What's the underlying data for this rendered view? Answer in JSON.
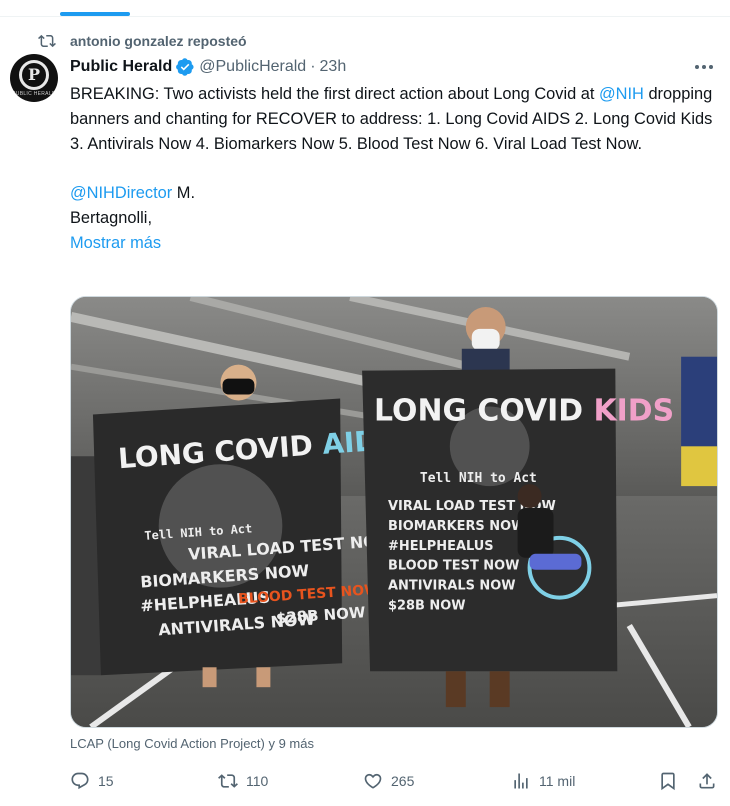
{
  "repost": {
    "text": "antonio gonzalez reposteó",
    "icon": "repost-icon"
  },
  "author": {
    "name": "Public Herald",
    "handle": "@PublicHerald",
    "separator": "·",
    "time": "23h",
    "avatar_text": "P",
    "avatar_caption": "PUBLIC HERALD",
    "verified": true
  },
  "tweet": {
    "p1_a": "BREAKING: Two activists held the first direct action about Long Covid at ",
    "p1_link": "@NIH",
    "p1_b": " dropping banners and chanting for RECOVER to address: 1. Long Covid AIDS 2. Long Covid Kids 3. Antivirals Now 4. Biomarkers Now 5. Blood Test Now 6. Viral Load Test Now.",
    "p2_link": "@NIHDirector",
    "p2_a": " M.",
    "p3": "Bertagnolli,",
    "show_more": "Mostrar más"
  },
  "media": {
    "banner_left": {
      "title_a": "LONG COVID",
      "title_b": "AIDS",
      "line1": "Tell NIH to Act",
      "line2": "VIRAL LOAD TEST NOW",
      "line3": "BIOMARKERS NOW",
      "line4": "#HELPHEALUS",
      "line5": "BLOOD TEST NOW",
      "line6": "ANTIVIRALS NOW",
      "line7": "$28B NOW"
    },
    "banner_right": {
      "title_a": "LONG COVID",
      "title_b": "KIDS",
      "line1": "Tell NIH to Act",
      "line2": "VIRAL LOAD TEST NOW",
      "line3": "BIOMARKERS NOW",
      "line4": "#HELPHEALUS",
      "line5": "BLOOD TEST NOW",
      "line6": "ANTIVIRALS NOW",
      "line7": "$28B NOW"
    },
    "caption": "LCAP (Long Covid Action Project) y 9 más"
  },
  "actions": {
    "replies": "15",
    "reposts": "110",
    "likes": "265",
    "views": "11 mil"
  },
  "colors": {
    "accent": "#1d9bf0",
    "muted": "#536471",
    "text": "#0f1419",
    "aids_blue": "#7fd0e6",
    "kids_pink": "#f0a0c8",
    "blood_red": "#e8541e"
  }
}
